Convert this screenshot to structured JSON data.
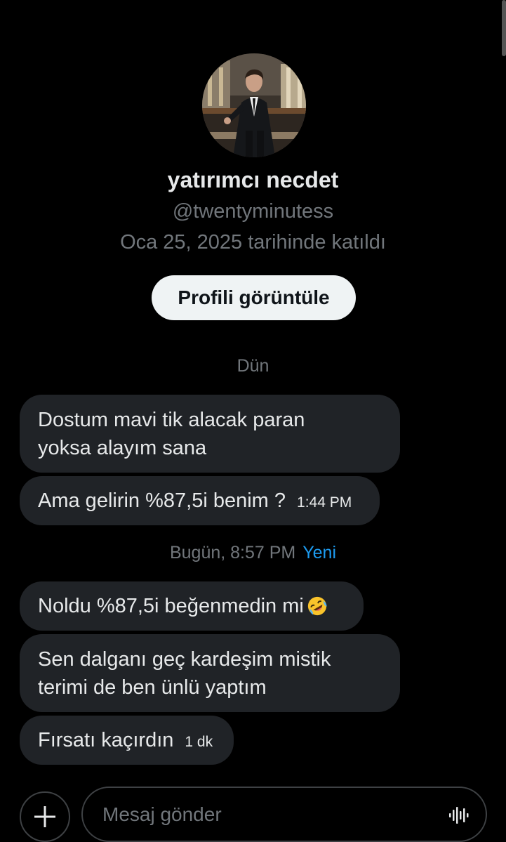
{
  "profile": {
    "display_name": "yatırımcı necdet",
    "handle": "@twentyminutess",
    "joined": "Oca 25, 2025 tarihinde katıldı",
    "view_profile_label": "Profili görüntüle"
  },
  "separators": [
    {
      "label": "Dün"
    },
    {
      "label": "Bugün, 8:57 PM",
      "badge": "Yeni"
    }
  ],
  "messages": [
    {
      "text": "Dostum mavi tik alacak paran\nyoksa alayım sana"
    },
    {
      "text": "Ama gelirin %87,5i benim ?",
      "time": "1:44 PM"
    },
    {
      "text": "Noldu %87,5i beğenmedin mi",
      "emoji": "rolling-on-floor-laughing"
    },
    {
      "text": "Sen dalganı geç kardeşim mistik\nterimi de ben ünlü yaptım"
    },
    {
      "text": "Fırsatı kaçırdın",
      "time": "1 dk"
    }
  ],
  "composer": {
    "placeholder": "Mesaj gönder"
  },
  "colors": {
    "background": "#000000",
    "bubble": "#202327",
    "muted": "#71767b",
    "accent": "#1d9bf0",
    "text": "#e7e9ea"
  }
}
